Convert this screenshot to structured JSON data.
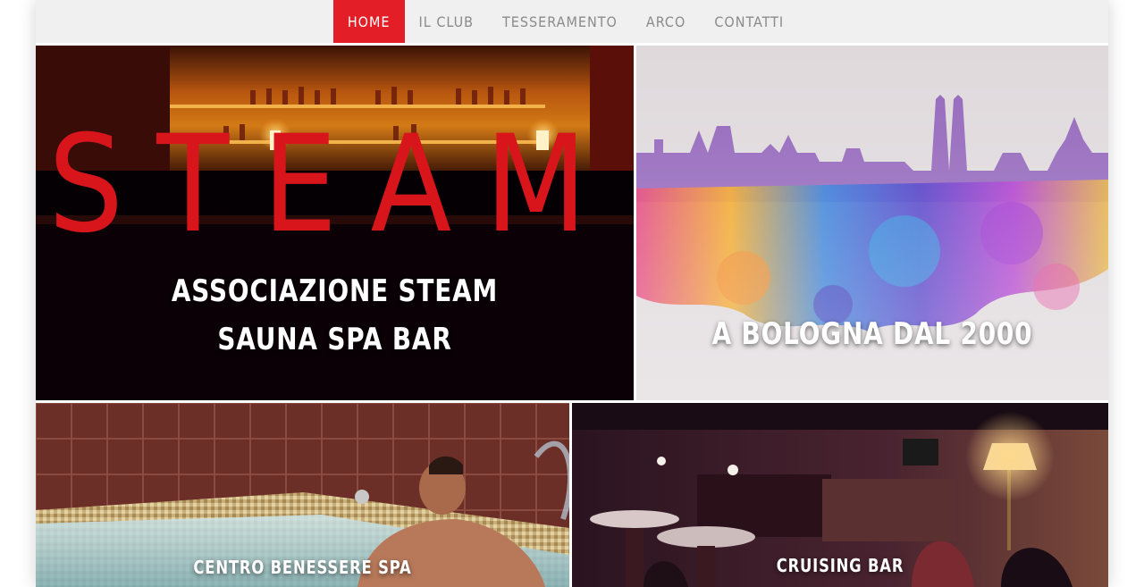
{
  "nav": {
    "items": [
      {
        "label": "HOME",
        "active": true
      },
      {
        "label": "IL CLUB",
        "active": false
      },
      {
        "label": "TESSERAMENTO",
        "active": false
      },
      {
        "label": "ARCO",
        "active": false
      },
      {
        "label": "CONTATTI",
        "active": false
      }
    ]
  },
  "tiles": {
    "steam": {
      "logo_text": "STEAM",
      "title_line1": "ASSOCIAZIONE STEAM",
      "title_line2": "SAUNA SPA BAR"
    },
    "bologna": {
      "title": "A BOLOGNA DAL 2000"
    },
    "spa": {
      "title": "CENTRO BENESSERE SPA"
    },
    "bar": {
      "title": "CRUISING BAR"
    }
  },
  "colors": {
    "accent": "#e41e26",
    "nav_bg": "#f0f0f0",
    "nav_text": "#8a8a8a",
    "caption_text": "#ffffff"
  }
}
